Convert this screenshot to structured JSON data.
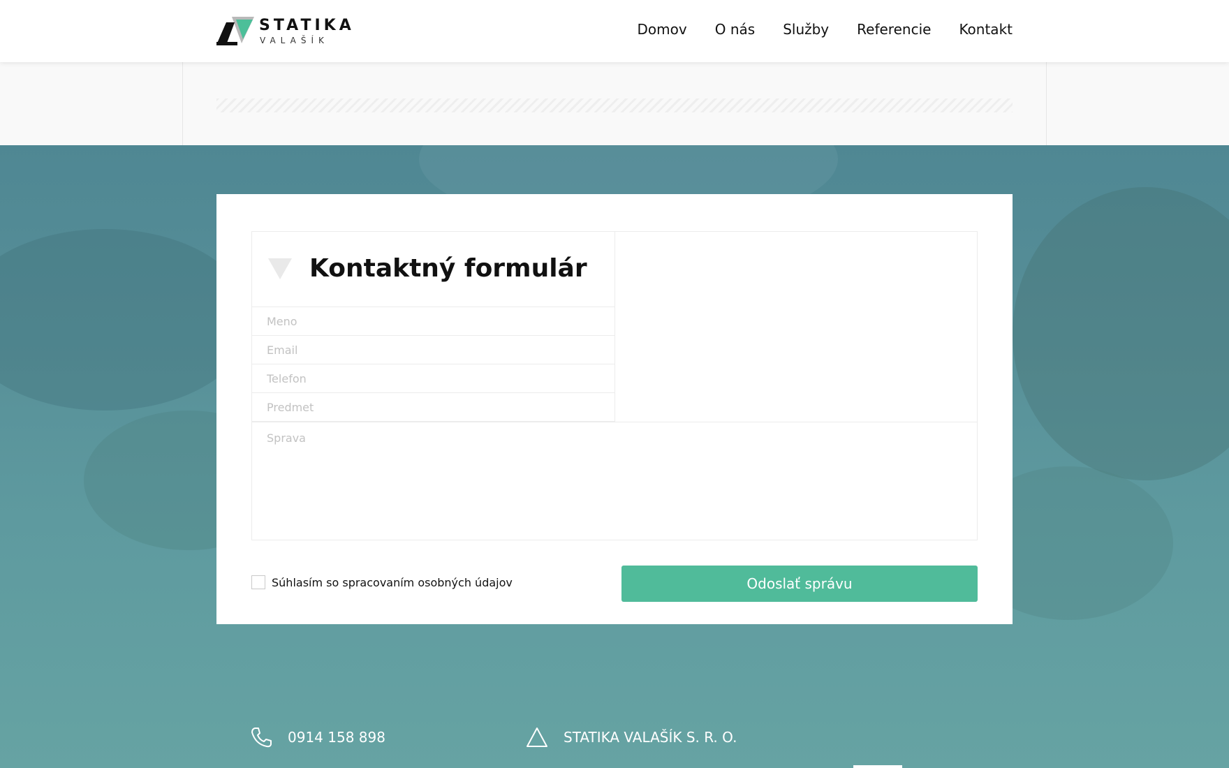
{
  "brand": {
    "title": "STATIKA",
    "subtitle": "VALAŠÍK"
  },
  "nav": {
    "items": [
      "Domov",
      "O nás",
      "Služby",
      "Referencie",
      "Kontakt"
    ]
  },
  "form": {
    "title": "Kontaktný formulár",
    "fields": {
      "name_placeholder": "Meno",
      "email_placeholder": "Email",
      "phone_placeholder": "Telefon",
      "subject_placeholder": "Predmet",
      "message_placeholder": "Sprava"
    },
    "consent_label": "Súhlasím so spracovaním osobných údajov",
    "submit_label": "Odoslať správu"
  },
  "footer": {
    "phone": "0914 158 898",
    "company": "STATIKA VALAŠÍK S. R. O."
  },
  "colors": {
    "accent": "#50bb9a",
    "background_teal": "#5e9a9f",
    "text": "#111111"
  },
  "icons": {
    "logo": "logo-triangle-icon",
    "form": "triangle-down-icon",
    "phone": "phone-icon",
    "company": "triangle-outline-icon"
  }
}
